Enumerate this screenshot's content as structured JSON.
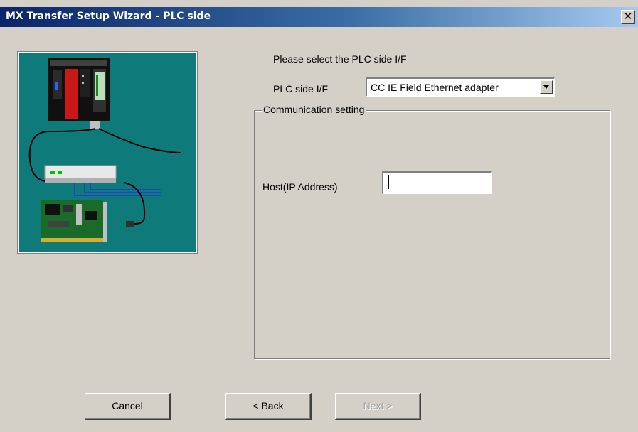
{
  "window": {
    "title": "MX Transfer Setup Wizard - PLC side",
    "close_label": "✕"
  },
  "form": {
    "prompt": "Please select the PLC side I/F",
    "iface_label": "PLC side I/F",
    "iface_selected": "CC IE Field Ethernet adapter",
    "comm_group_title": "Communication setting",
    "host_label": "Host(IP Address)",
    "host_value": ""
  },
  "buttons": {
    "cancel": "Cancel",
    "back": "< Back",
    "next": "Next >",
    "next_enabled": false
  },
  "colors": {
    "panel_bg": "#d4d0c8",
    "image_bg": "#0e7a7a",
    "title_gradient_start": "#0a246a",
    "title_gradient_end": "#a6caf0"
  },
  "icons": {
    "illustration": "plc-network-diagram",
    "close": "close-icon",
    "dropdown": "chevron-down-icon"
  }
}
